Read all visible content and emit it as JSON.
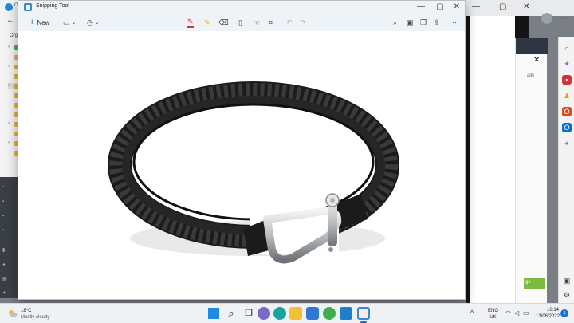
{
  "browser": {
    "tab_title": "Or",
    "org_label": "Orga",
    "back_icon": "back-arrow-icon"
  },
  "snipping_tool": {
    "title": "Snipping Tool",
    "new_label": "New",
    "accent": "#1c5fb0",
    "pen_color": "#d13438",
    "highlighter_color": "#e8b800",
    "icons": [
      "rectangle-mode-icon",
      "timer-icon",
      "ballpoint-pen-icon",
      "highlighter-icon",
      "eraser-icon",
      "ruler-icon",
      "touch-writing-icon",
      "crop-icon",
      "undo-icon",
      "redo-icon",
      "zoom-icon",
      "save-icon",
      "copy-icon",
      "share-icon",
      "more-icon"
    ]
  },
  "background_window": {
    "details_text": "ails",
    "green_button_text": "ge",
    "partial_label": "erflery"
  },
  "taskbar": {
    "weather_temp": "18°C",
    "weather_desc": "Mostly cloudy",
    "lang_top": "ENG",
    "lang_bottom": "UK",
    "time": "16:14",
    "date": "13/06/2022",
    "notification_count": "1"
  }
}
